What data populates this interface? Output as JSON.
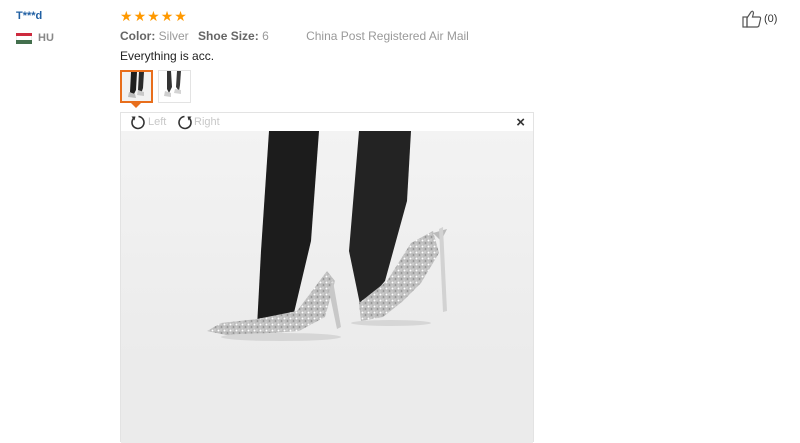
{
  "review": {
    "reviewer": "T***d",
    "country_code": "HU",
    "flag_colors": [
      "#cd2a3e",
      "#ffffff",
      "#436f4d"
    ],
    "rating": 5,
    "star_color": "#ff9900",
    "attributes": [
      {
        "key": "Color:",
        "value": "Silver"
      },
      {
        "key": "Shoe Size:",
        "value": "6"
      }
    ],
    "shipping": "China Post Registered Air Mail",
    "text": "Everything is acc.",
    "thumbnails": [
      {
        "name": "photo-1",
        "active": true
      },
      {
        "name": "photo-2",
        "active": false
      }
    ],
    "viewer": {
      "rotate_left_label": "Left",
      "rotate_right_label": "Right",
      "close_symbol": "×",
      "photo_icon": "review-photo-silver-glitter-heels"
    },
    "helpful": {
      "icon": "thumbs-up-icon",
      "count_label": "(0)"
    }
  }
}
